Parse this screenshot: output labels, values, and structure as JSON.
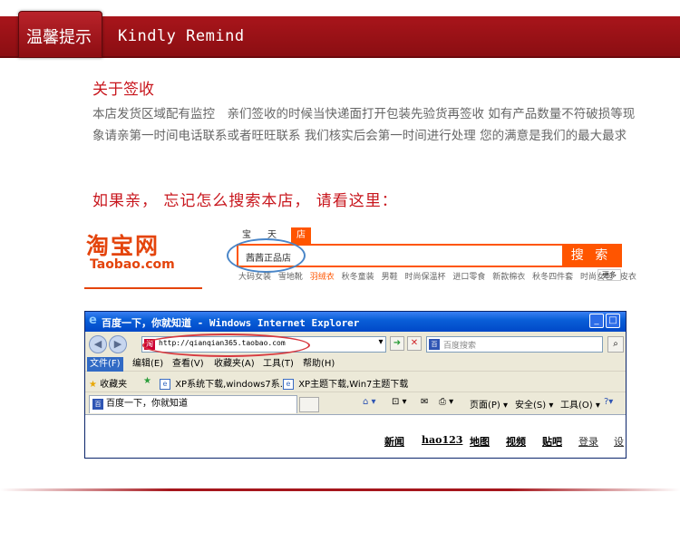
{
  "header": {
    "badge": "温馨提示",
    "title": "Kindly Remind"
  },
  "section_sign": {
    "title": "关于签收",
    "body": "本店发货区域配有监控　亲们签收的时候当快递面打开包装先验货再签收 如有产品数量不符破损等现象请亲第一时间电话联系或者旺旺联系 我们核实后会第一时间进行处理 您的满意是我们的最大最求"
  },
  "remind": "如果亲， 忘记怎么搜索本店， 请看这里：",
  "taobao": {
    "logo_cn": "淘宝网",
    "logo_en": "Taobao.com",
    "tabs": [
      "宝贝",
      "天猫",
      "店铺"
    ],
    "search_value": "茜茜正品店",
    "search_button": "搜 索",
    "hot_words": [
      "大码女装",
      "雪地靴",
      "羽绒衣",
      "秋冬童装",
      "男鞋",
      "时尚保温杯",
      "进口零食",
      "新款棉衣",
      "秋冬四件套",
      "时尚女包",
      "皮衣"
    ],
    "more": "更多"
  },
  "ie": {
    "title": "百度一下，你就知道 - Windows Internet Explorer",
    "address": "http://qianqian365.taobao.com",
    "search_placeholder": "百度搜索",
    "menus": [
      "文件(F)",
      "编辑(E)",
      "查看(V)",
      "收藏夹(A)",
      "工具(T)",
      "帮助(H)"
    ],
    "favorites_label": "收藏夹",
    "fav_links": [
      "XP系统下载,windows7系...",
      "XP主题下载,Win7主题下载"
    ],
    "tab_title": "百度一下，你就知道",
    "toolbar": {
      "page": "页面(P)",
      "safety": "安全(S)",
      "tools": "工具(O)"
    },
    "page_links": [
      "新闻",
      "hao123",
      "地图",
      "视频",
      "贴吧",
      "登录",
      "设"
    ]
  }
}
